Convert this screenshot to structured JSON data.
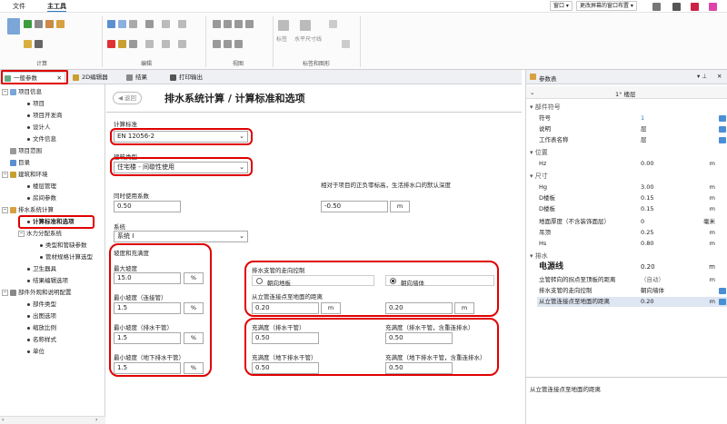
{
  "menu": {
    "file": "文件",
    "home": "主工具",
    "window_btn": "窗口",
    "layout_btn": "更改屏幕的窗口布置"
  },
  "ribbon": {
    "groups": [
      "计算",
      "编辑",
      "视图",
      "标签和图形"
    ],
    "label_btn": "标签",
    "dim_btn": "水平尺寸线"
  },
  "tabs": [
    {
      "label": "一般参数"
    },
    {
      "label": "2D编辑器"
    },
    {
      "label": "结果"
    },
    {
      "label": "打印输出"
    }
  ],
  "tree": [
    {
      "label": "项目信息",
      "level": 0,
      "toggle": "−"
    },
    {
      "label": "项目",
      "level": 1
    },
    {
      "label": "项目开发商",
      "level": 1
    },
    {
      "label": "设计人",
      "level": 1
    },
    {
      "label": "文件信息",
      "level": 1
    },
    {
      "label": "项目范围",
      "level": 0
    },
    {
      "label": "目录",
      "level": 0
    },
    {
      "label": "建筑和环境",
      "level": 0,
      "toggle": "−"
    },
    {
      "label": "楼层管理",
      "level": 1
    },
    {
      "label": "房间参数",
      "level": 1
    },
    {
      "label": "排水系统计算",
      "level": 0,
      "toggle": "−"
    },
    {
      "label": "计算标准和选项",
      "level": 1
    },
    {
      "label": "水力分配系统",
      "level": 1,
      "toggle": "−"
    },
    {
      "label": "类型和管缺参数",
      "level": 2
    },
    {
      "label": "管材规格计算选型",
      "level": 2
    },
    {
      "label": "卫生器具",
      "level": 1
    },
    {
      "label": "结果编辑选项",
      "level": 1
    },
    {
      "label": "部件外观和说明配置",
      "level": 0,
      "toggle": "−"
    },
    {
      "label": "部件类型",
      "level": 1
    },
    {
      "label": "出图选项",
      "level": 1
    },
    {
      "label": "缩放比例",
      "level": 1
    },
    {
      "label": "名称样式",
      "level": 1
    },
    {
      "label": "单位",
      "level": 1
    }
  ],
  "main": {
    "back": "返回",
    "title": "排水系统计算 / 计算标准和选项",
    "calc_std_label": "计算标准",
    "calc_std_value": "EN 12056-2",
    "building_type_label": "建筑类型",
    "building_type_value": "住宅楼 - 间歇性使用",
    "simul_label": "同时使用系数",
    "simul_value": "0.50",
    "depth_note": "相对于项目的正负零标高，生活排水口的默认深度",
    "depth_value": "-0.50",
    "depth_unit": "m",
    "system_label": "系统",
    "system_value": "系统 I",
    "slope_section": "坡度和充满度",
    "max_slope_label": "最大坡度",
    "max_slope_value": "15.0",
    "min_slope_conn_label": "最小坡度（连接管）",
    "min_slope_conn_value": "1.5",
    "min_slope_main_label": "最小坡度（排水干管）",
    "min_slope_main_value": "1.5",
    "min_slope_under_label": "最小坡度（地下排水干管）",
    "min_slope_under_value": "1.5",
    "pct": "%",
    "dir_section": "排水支管的走向控制",
    "dir_floor": "朝向地板",
    "dir_wall": "朝向墙体",
    "dist_label": "从立管连接点至地面的距离",
    "dist1_value": "0.20",
    "dist2_value": "0.20",
    "m": "m",
    "fill_main_label": "充满度（排水干管）",
    "fill_main_value": "0.50",
    "fill_main_incl_label": "充满度（排水干管，含重连排水）",
    "fill_main_incl_value": "0.50",
    "fill_under_label": "充满度（地下排水干管）",
    "fill_under_value": "0.50",
    "fill_under_incl_label": "充满度（地下排水干管，含重连排水）",
    "fill_under_incl_value": "0.50"
  },
  "props": {
    "title": "参数表",
    "floor": "1° 楼层",
    "sections": {
      "symbol": "部件符号",
      "position": "位置",
      "size": "尺寸",
      "drain": "排水"
    },
    "rows": {
      "symbol": {
        "k": "符号",
        "v": "1"
      },
      "desc": {
        "k": "说明",
        "v": "层"
      },
      "sheet": {
        "k": "工作表名称",
        "v": "层"
      },
      "hz": {
        "k": "Hz",
        "v": "0.00",
        "u": "m"
      },
      "hg": {
        "k": "Hg",
        "v": "3.00",
        "u": "m"
      },
      "d1": {
        "k": "D楼板",
        "v": "0.15",
        "u": "m"
      },
      "d2": {
        "k": "D楼板",
        "v": "0.15",
        "u": "m"
      },
      "floor_thk": {
        "k": "地面厚度（不含装饰面层）",
        "v": "0",
        "u": "毫米"
      },
      "ceil": {
        "k": "吊顶",
        "v": "0.25",
        "u": "m"
      },
      "hs": {
        "k": "Hs",
        "v": "0.80",
        "u": "m"
      },
      "power": {
        "k": "电源线",
        "v": "0.20",
        "u": "m"
      },
      "riser_dist": {
        "k": "立管转向的拐点至顶板的距离",
        "v": "（自动）",
        "u": "m"
      },
      "branch_dir": {
        "k": "排水支管的走向控制",
        "v": "朝向墙体"
      },
      "riser_floor": {
        "k": "从立管连接点至地面的距离",
        "v": "0.20",
        "u": "m"
      }
    },
    "footer": "从立管连接点至地面的距离"
  },
  "colors": {
    "highlight": "#e00000",
    "accent": "#2b78c5"
  }
}
